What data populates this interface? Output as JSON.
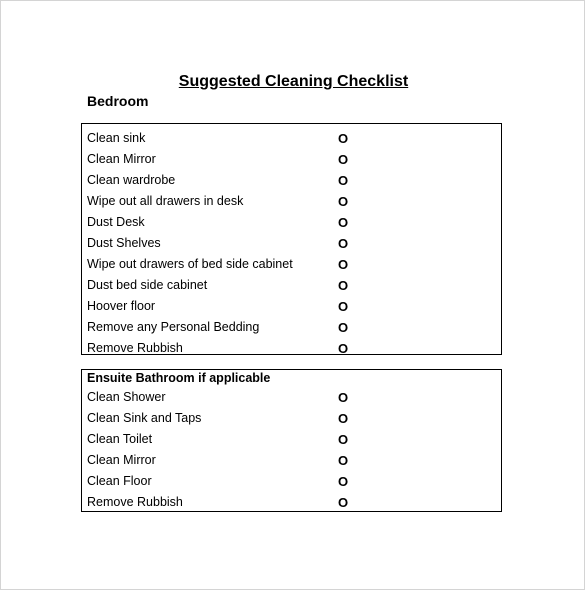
{
  "document": {
    "title": "Suggested Cleaning Checklist",
    "bedroom": {
      "heading": "Bedroom",
      "items": [
        {
          "label": "Clean sink",
          "check": "O"
        },
        {
          "label": "Clean Mirror",
          "check": "O"
        },
        {
          "label": "Clean wardrobe",
          "check": "O"
        },
        {
          "label": "Wipe out all drawers in desk",
          "check": "O"
        },
        {
          "label": "Dust Desk",
          "check": "O"
        },
        {
          "label": "Dust Shelves",
          "check": "O"
        },
        {
          "label": "Wipe out drawers of bed side cabinet",
          "check": "O"
        },
        {
          "label": "Dust bed side cabinet",
          "check": "O"
        },
        {
          "label": "Hoover floor",
          "check": "O"
        },
        {
          "label": "Remove any Personal Bedding",
          "check": "O"
        },
        {
          "label": "Remove Rubbish",
          "check": "O"
        }
      ]
    },
    "bathroom": {
      "heading": "Ensuite Bathroom if applicable",
      "items": [
        {
          "label": "Clean Shower",
          "check": "O"
        },
        {
          "label": "Clean Sink and Taps",
          "check": "O"
        },
        {
          "label": "Clean Toilet",
          "check": "O"
        },
        {
          "label": "Clean Mirror",
          "check": "O"
        },
        {
          "label": "Clean Floor",
          "check": "O"
        },
        {
          "label": "Remove Rubbish",
          "check": "O"
        }
      ]
    }
  }
}
